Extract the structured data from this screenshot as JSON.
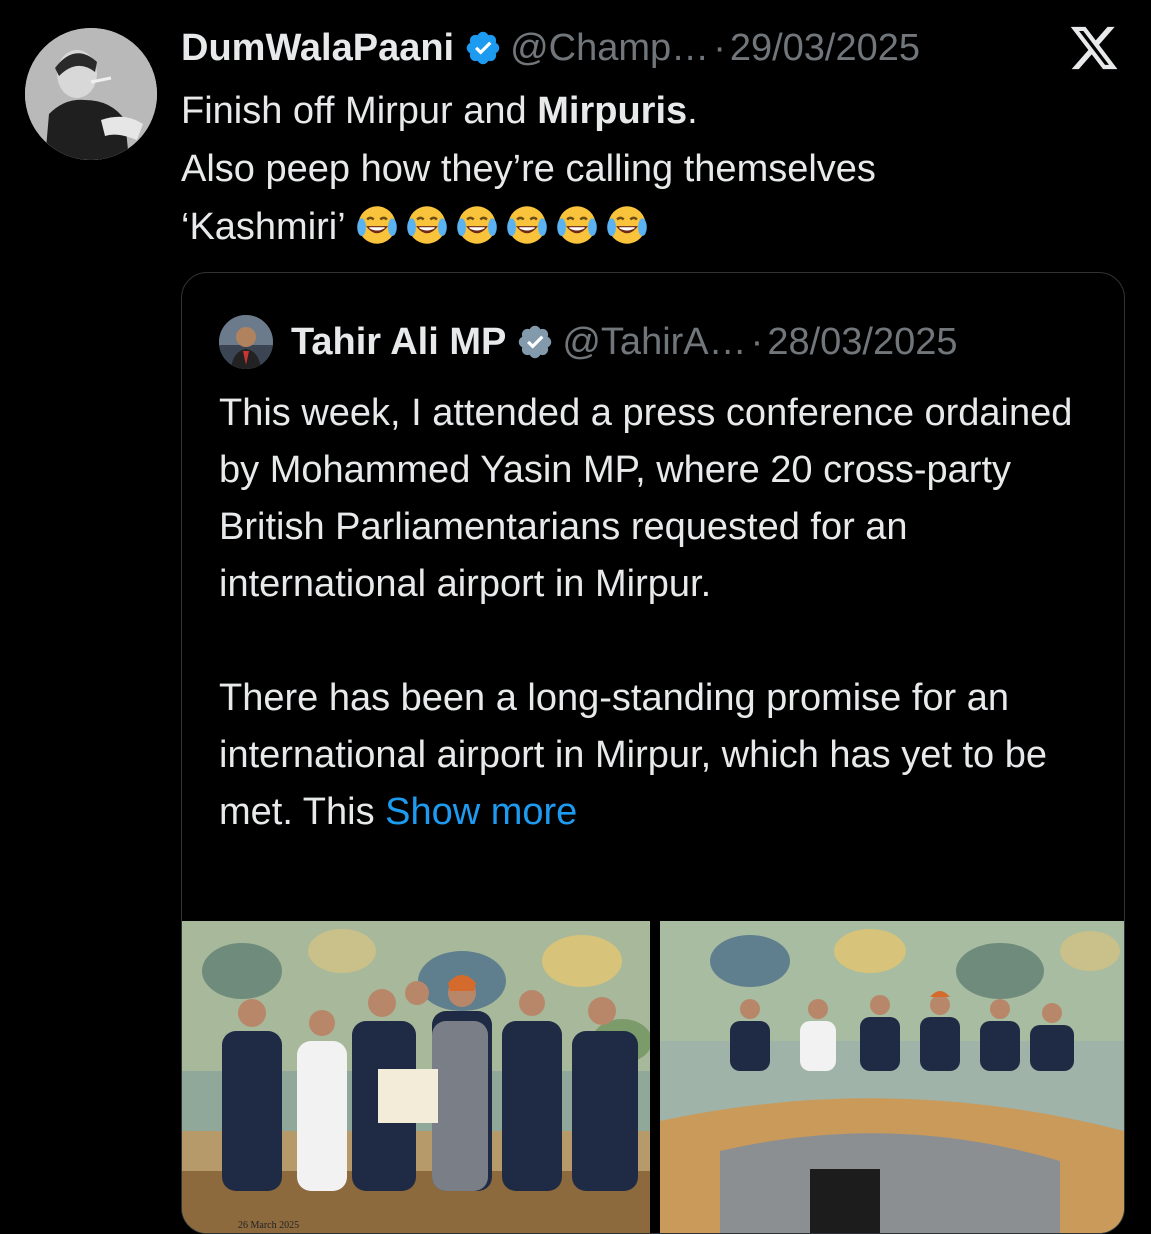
{
  "tweet": {
    "display_name": "DumWalaPaani",
    "handle": "@Champ…",
    "separator": "·",
    "date": "29/03/2025",
    "text_line1_pre": "Finish off Mirpur and ",
    "text_line1_bold": "Mirpuris",
    "text_line1_post": ".",
    "text_line2": "Also peep how they’re calling themselves",
    "text_line3": "‘Kashmiri’",
    "emoji_count": 6,
    "emoji_name": "face-with-tears-of-joy"
  },
  "quoted": {
    "display_name": "Tahir Ali MP",
    "handle": "@TahirA…",
    "separator": "·",
    "date": "28/03/2025",
    "paragraph1": "This week, I attended a press conference ordained by Mohammed Yasin MP, where 20 cross-party British Parliamentarians requested for an international airport in Mirpur.",
    "paragraph2": "There has been a long-standing promise for an international airport in Mirpur, which has yet to be met. This ",
    "show_more": "Show more",
    "photo_caption": "26 March 2025"
  },
  "colors": {
    "background": "#000000",
    "text_primary": "#e7e9ea",
    "text_secondary": "#71767b",
    "link": "#1d9bf0",
    "border": "#2f3336",
    "verified_badge": "#1d9bf0"
  },
  "icons": [
    "verified-badge-icon",
    "x-logo-icon",
    "face-with-tears-of-joy-emoji"
  ]
}
